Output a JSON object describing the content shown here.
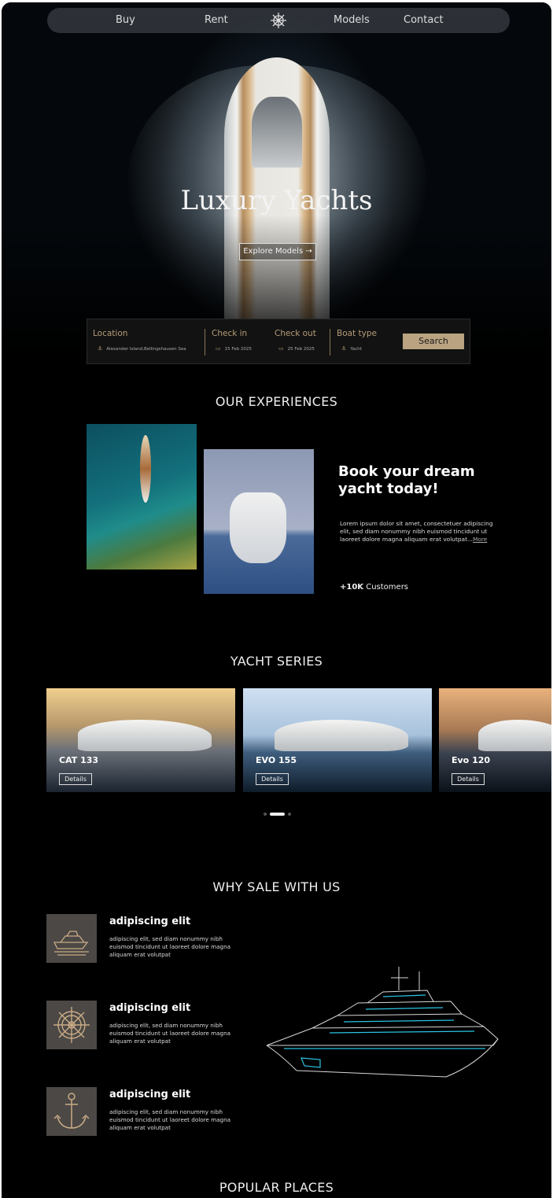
{
  "nav": {
    "items": [
      "Buy",
      "Rent",
      "Models",
      "Contact"
    ],
    "logo_icon": "ships-wheel-icon"
  },
  "hero": {
    "title": "Luxury Yachts",
    "cta": "Explore Models",
    "cta_icon": "arrow-right-icon"
  },
  "search": {
    "location_label": "Location",
    "location_value": "Alexander Island,Bellingshausen Sea",
    "location_icon": "anchor-icon",
    "checkin_label": "Check in",
    "checkin_value": "15 Feb 2025",
    "checkin_icon": "calendar-icon",
    "checkout_label": "Check out",
    "checkout_value": "25 Feb 2025",
    "checkout_icon": "calendar-icon",
    "boattype_label": "Boat type",
    "boattype_value": "Yacht",
    "boattype_icon": "anchor-icon",
    "button": "Search",
    "accent": "#b9a380"
  },
  "experiences": {
    "title": "OUR EXPERIENCES",
    "heading": "Book your dream yacht today!",
    "body": "Lorem ipsum dolor sit amet, consectetuer adipiscing elit, sed diam nonummy nibh euismod tincidunt ut laoreet dolore magna aliquam erat volutpat...",
    "more": "More",
    "customers_count": "+10K",
    "customers_label": "Customers"
  },
  "series": {
    "title": "YACHT SERIES",
    "cards": [
      {
        "name": "CAT 133",
        "button": "Details"
      },
      {
        "name": "EVO 155",
        "button": "Details"
      },
      {
        "name": "Evo 120",
        "button": "Details"
      }
    ],
    "active_index": 1
  },
  "why": {
    "title": "WHY SALE WITH US",
    "features": [
      {
        "heading": "adipiscing elit",
        "body": "adipiscing elit, sed diam nonummy nibh euismod tincidunt ut laoreet dolore magna aliquam erat volutpat",
        "icon": "yacht-icon"
      },
      {
        "heading": "adipiscing elit",
        "body": "adipiscing elit, sed diam nonummy nibh euismod tincidunt ut laoreet dolore magna aliquam erat volutpat",
        "icon": "ships-wheel-icon"
      },
      {
        "heading": "adipiscing elit",
        "body": "adipiscing elit, sed diam nonummy nibh euismod tincidunt ut laoreet dolore magna aliquam erat volutpat",
        "icon": "anchor-icon"
      }
    ],
    "illustration_icon": "yacht-wireframe-icon"
  },
  "popular": {
    "title": "POPULAR PLACES"
  }
}
